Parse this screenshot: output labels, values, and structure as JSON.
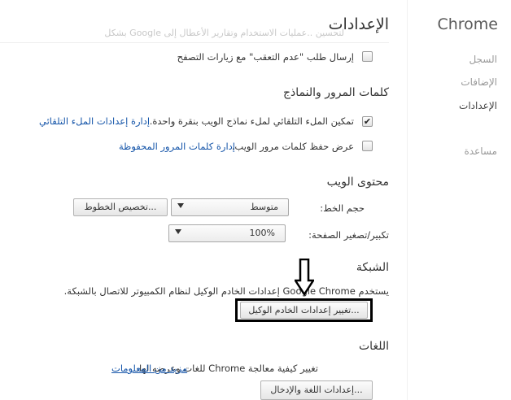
{
  "sidebar": {
    "brand": "Chrome",
    "items": [
      {
        "label": "السجل"
      },
      {
        "label": "الإضافات"
      },
      {
        "label": "الإعدادات"
      },
      {
        "label": "مساعدة"
      }
    ]
  },
  "header": {
    "title": "الإعدادات",
    "faded_text": "لتحسين ..عمليات الاستخدام وتقارير الأعطال إلى Google بشكل"
  },
  "privacy": {
    "dnt_label": "إرسال طلب \"عدم التعقب\" مع زيارات التصفح",
    "dnt_checked": false
  },
  "passwords": {
    "title": "كلمات المرور والنماذج",
    "autofill_label": "تمكين الملء التلقائي لملء نماذج الويب بنقرة واحدة.",
    "autofill_checked": true,
    "autofill_link": "إدارة إعدادات الملء التلقائي",
    "save_label": "عرض حفظ كلمات مرور الويب.",
    "save_checked": false,
    "save_link": "إدارة كلمات المرور المحفوظة"
  },
  "web_content": {
    "title": "محتوى الويب",
    "font_size_label": "حجم الخط:",
    "font_size_value": "متوسط",
    "customize_fonts_button": "تخصيص الخطوط...",
    "zoom_label": "تكبير/تصغير الصفحة:",
    "zoom_value": "100%"
  },
  "network": {
    "title": "الشبكة",
    "description": "يستخدم Google Chrome إعدادات الخادم الوكيل لنظام الكمبيوتر للاتصال بالشبكة.",
    "proxy_button": "تغيير إعدادات الخادم الوكيل..."
  },
  "languages": {
    "title": "اللغات",
    "description": "تغيير كيفية معالجة Chrome للغات وعرضه لها.",
    "learn_more": "مزيد من المعلومات",
    "settings_button": "إعدادات اللغة والإدخال..."
  },
  "colors": {
    "link": "#1555a9",
    "annotation": "#000000"
  }
}
